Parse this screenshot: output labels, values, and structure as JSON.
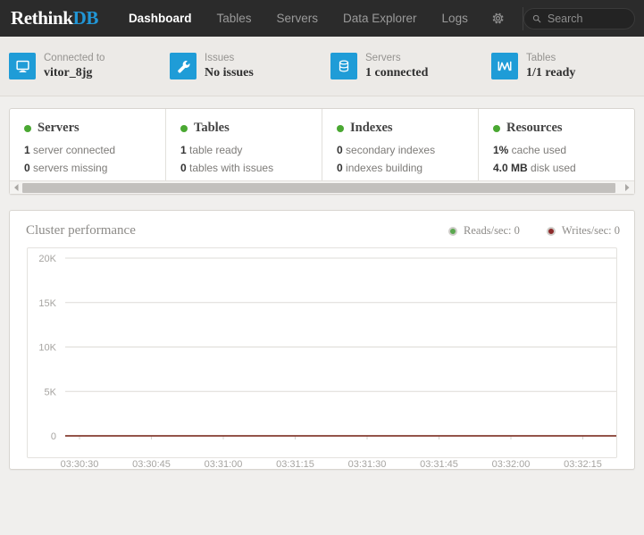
{
  "brand": {
    "name_primary": "Rethink",
    "name_accent": "DB",
    "accent_color": "#2196d6"
  },
  "nav": {
    "items": [
      {
        "label": "Dashboard",
        "active": true
      },
      {
        "label": "Tables",
        "active": false
      },
      {
        "label": "Servers",
        "active": false
      },
      {
        "label": "Data Explorer",
        "active": false
      },
      {
        "label": "Logs",
        "active": false
      }
    ],
    "settings_icon": "gear-icon"
  },
  "search": {
    "placeholder": "Search",
    "value": "",
    "icon": "search-icon"
  },
  "status_items": [
    {
      "icon": "monitor-icon",
      "label": "Connected to",
      "value": "vitor_8jg"
    },
    {
      "icon": "wrench-icon",
      "label": "Issues",
      "value": "No issues"
    },
    {
      "icon": "database-icon",
      "label": "Servers",
      "value": "1 connected"
    },
    {
      "icon": "peak-chart-icon",
      "label": "Tables",
      "value": "1/1 ready"
    }
  ],
  "cards": [
    {
      "title": "Servers",
      "status_color": "#4aa832",
      "lines": [
        {
          "value": "1",
          "text": " server connected"
        },
        {
          "value": "0",
          "text": " servers missing"
        }
      ]
    },
    {
      "title": "Tables",
      "status_color": "#4aa832",
      "lines": [
        {
          "value": "1",
          "text": " table ready"
        },
        {
          "value": "0",
          "text": " tables with issues"
        }
      ]
    },
    {
      "title": "Indexes",
      "status_color": "#4aa832",
      "lines": [
        {
          "value": "0",
          "text": " secondary indexes"
        },
        {
          "value": "0",
          "text": " indexes building"
        }
      ]
    },
    {
      "title": "Resources",
      "status_color": "#4aa832",
      "lines": [
        {
          "value": "1%",
          "text": " cache used"
        },
        {
          "value": "4.0 MB",
          "text": " disk used"
        }
      ]
    }
  ],
  "performance": {
    "title": "Cluster performance",
    "legend": [
      {
        "label": "Reads/sec: 0",
        "color": "#5aa84f"
      },
      {
        "label": "Writes/sec: 0",
        "color": "#8c2b2b"
      }
    ]
  },
  "chart_data": {
    "type": "line",
    "title": "Cluster performance",
    "xlabel": "",
    "ylabel": "",
    "ylim": [
      0,
      20000
    ],
    "yticks": [
      0,
      5000,
      10000,
      15000,
      20000
    ],
    "ytick_labels": [
      "0",
      "5K",
      "10K",
      "15K",
      "20K"
    ],
    "x": [
      "03:30:30",
      "03:30:45",
      "03:31:00",
      "03:31:15",
      "03:31:30",
      "03:31:45",
      "03:32:00",
      "03:32:15"
    ],
    "grid": true,
    "legend_position": "top-right",
    "series": [
      {
        "name": "Reads/sec",
        "color": "#5aa84f",
        "values": [
          0,
          0,
          0,
          0,
          0,
          0,
          0,
          0
        ]
      },
      {
        "name": "Writes/sec",
        "color": "#8c2b2b",
        "values": [
          0,
          0,
          0,
          0,
          0,
          0,
          0,
          0
        ]
      }
    ]
  }
}
